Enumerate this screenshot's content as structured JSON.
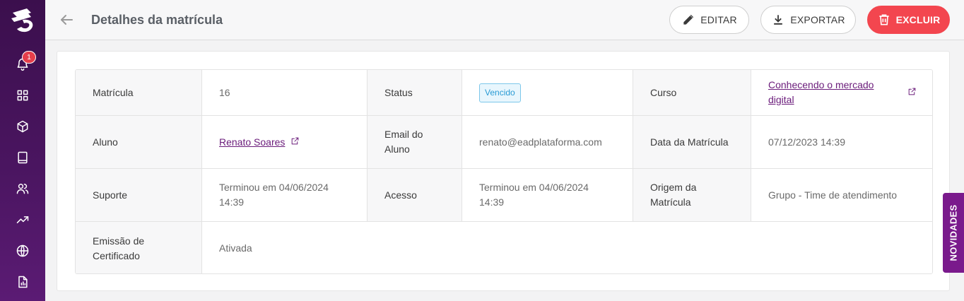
{
  "sidebar": {
    "notification_count": "1",
    "icons": [
      "bell-icon",
      "grid-icon",
      "cube-icon",
      "book-icon",
      "users-icon",
      "trending-up-icon",
      "globe-icon",
      "report-icon"
    ]
  },
  "header": {
    "title": "Detalhes da matrícula",
    "edit_label": "EDITAR",
    "export_label": "EXPORTAR",
    "delete_label": "EXCLUIR"
  },
  "details": {
    "matricula_label": "Matrícula",
    "matricula_value": "16",
    "status_label": "Status",
    "status_value": "Vencido",
    "curso_label": "Curso",
    "curso_value": "Conhecendo o mercado digital",
    "aluno_label": "Aluno",
    "aluno_value": "Renato Soares",
    "email_label": "Email do Aluno",
    "email_value": "renato@eadplataforma.com",
    "data_label": "Data da Matrícula",
    "data_value": "07/12/2023 14:39",
    "suporte_label": "Suporte",
    "suporte_value": "Terminou em 04/06/2024 14:39",
    "acesso_label": "Acesso",
    "acesso_value": "Terminou em 04/06/2024 14:39",
    "origem_label": "Origem da Matrícula",
    "origem_value": "Grupo - Time de atendimento",
    "certificado_label": "Emissão de Certificado",
    "certificado_value": "Ativada"
  },
  "novidades_label": "NOVIDADES",
  "colors": {
    "sidebar": "#4a1560",
    "accent": "#6a1b7a",
    "delete": "#f3464f",
    "status_badge": "#2a9bd4"
  }
}
